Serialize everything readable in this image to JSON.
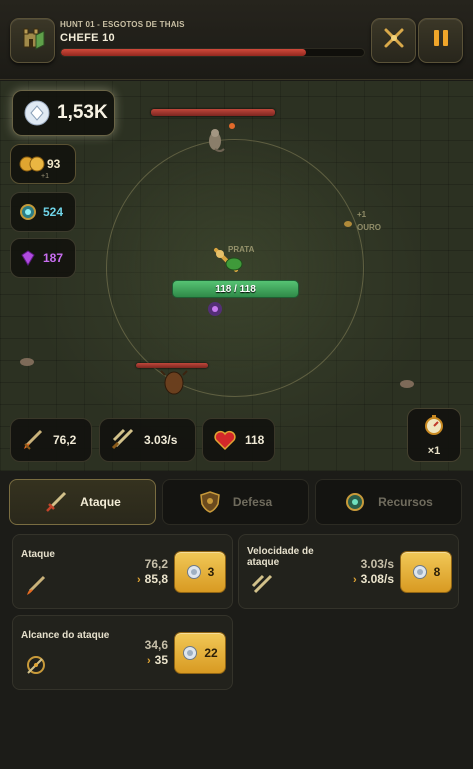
{
  "header": {
    "hunt_subtitle": "HUNT 01 - ESGOTOS DE THAIS",
    "boss_title": "CHEFE 10",
    "boss_hp_fraction": 0.81
  },
  "resources": {
    "crystal": "1,53K",
    "gold": "93",
    "gold_sub": "+1",
    "gems_blue": "524",
    "gems_purple": "187"
  },
  "field": {
    "player_hp": "118 / 118",
    "float_ouro": "OURO",
    "float_ouro_plus": "+1",
    "float_prata": "PRATA"
  },
  "stats": {
    "attack": "76,2",
    "attack_speed": "3.03/s",
    "health": "118"
  },
  "speed": {
    "multiplier": "×1"
  },
  "tabs": [
    {
      "label": "Ataque",
      "active": true
    },
    {
      "label": "Defesa",
      "active": false
    },
    {
      "label": "Recursos",
      "active": false
    }
  ],
  "upgrades": [
    {
      "title": "Ataque",
      "current": "76,2",
      "next": "85,8",
      "cost": "3"
    },
    {
      "title": "Velocidade de ataque",
      "current": "3.03/s",
      "next": "3.08/s",
      "cost": "8"
    },
    {
      "title": "Alcance do ataque",
      "current": "34,6",
      "next": "35",
      "cost": "22"
    }
  ],
  "colors": {
    "gold_button": "#e5b23d",
    "boss_hp": "#c0392b",
    "player_hp": "#4caf68",
    "blue_gem": "#6fd4e8",
    "purple_gem": "#c86ef0"
  }
}
